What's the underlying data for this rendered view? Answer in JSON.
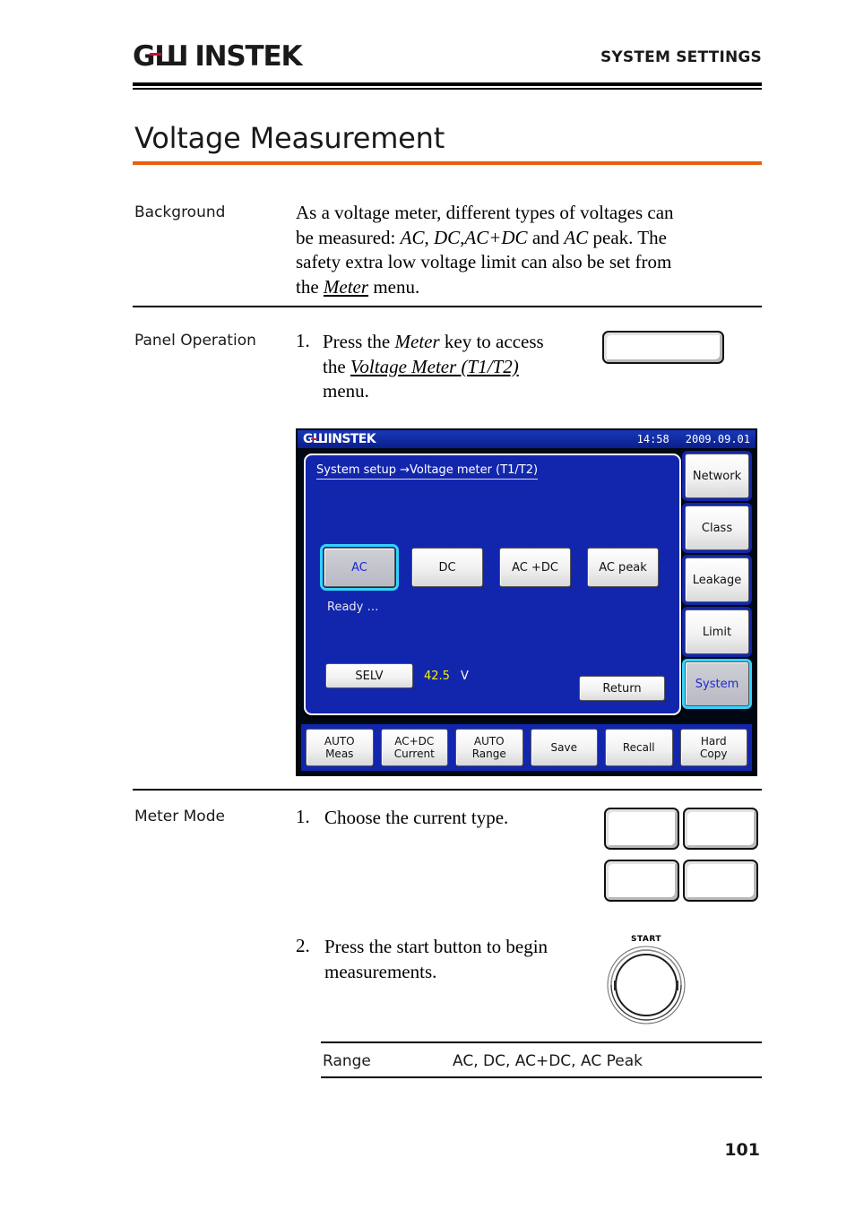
{
  "header": {
    "logo_gw": "GШ",
    "logo_instek": "INSTEK",
    "title": "SYSTEM SETTINGS"
  },
  "page_title": "Voltage Measurement",
  "page_number": "101",
  "sections": {
    "background": {
      "label": "Background",
      "text_line1_a": "As a voltage meter, different types of voltages can",
      "text_line2_a": "be measured: ",
      "text_line2_i1": "AC",
      "text_line2_b": ", ",
      "text_line2_i2": "DC,AC+DC",
      "text_line2_c": " and ",
      "text_line2_i3": "AC",
      "text_line2_d": " peak. The",
      "text_line3_a": "safety extra low voltage limit can also be set from",
      "text_line4_a": "the ",
      "text_line4_i": "Meter",
      "text_line4_b": " menu."
    },
    "panel_operation": {
      "label": "Panel Operation",
      "step1_num": "1.",
      "step1_a": "Press the ",
      "step1_i": "Meter",
      "step1_b": " key to access",
      "step1_line2_a": "the ",
      "step1_line2_i": "Voltage Meter (T1/T2)",
      "step1_line3": "menu."
    },
    "meter_mode": {
      "label": "Meter Mode",
      "step1_num": "1.",
      "step1_text": "Choose the current type.",
      "step2_num": "2.",
      "step2_line1": "Press the start button to begin",
      "step2_line2": "measurements.",
      "knob_label": "START"
    },
    "range": {
      "label": "Range",
      "value": "AC, DC, AC+DC, AC Peak"
    }
  },
  "device": {
    "topbar": {
      "logo_gw": "GШ",
      "logo_instek": "INSTEK",
      "time": "14:58",
      "date": "2009.09.01"
    },
    "breadcrumb": "System setup →Voltage meter (T1/T2)",
    "mode_buttons": [
      {
        "label": "AC",
        "selected": true
      },
      {
        "label": "DC",
        "selected": false
      },
      {
        "label": "AC +DC",
        "selected": false
      },
      {
        "label": "AC peak",
        "selected": false
      }
    ],
    "status": "Ready …",
    "selv_button": "SELV",
    "selv_value": "42.5",
    "selv_unit": "V",
    "return_button": "Return",
    "sidebar": [
      {
        "label": "Network",
        "selected": false
      },
      {
        "label": "Class",
        "selected": false
      },
      {
        "label": "Leakage",
        "selected": false
      },
      {
        "label": "Limit",
        "selected": false
      },
      {
        "label": "System",
        "selected": true
      }
    ],
    "function_bar": [
      {
        "line1": "AUTO",
        "line2": "Meas"
      },
      {
        "line1": "AC+DC",
        "line2": "Current"
      },
      {
        "line1": "AUTO",
        "line2": "Range"
      },
      {
        "line1": "Save",
        "line2": ""
      },
      {
        "line1": "Recall",
        "line2": ""
      },
      {
        "line1": "Hard",
        "line2": "Copy"
      }
    ]
  },
  "colors": {
    "accent_orange": "#e8610f",
    "screen_blue": "#1226ad",
    "topbar_blue": "#1838b8",
    "selected_cyan": "#35d2ff",
    "value_yellow": "#f5f000",
    "logo_red": "#c8102e"
  }
}
